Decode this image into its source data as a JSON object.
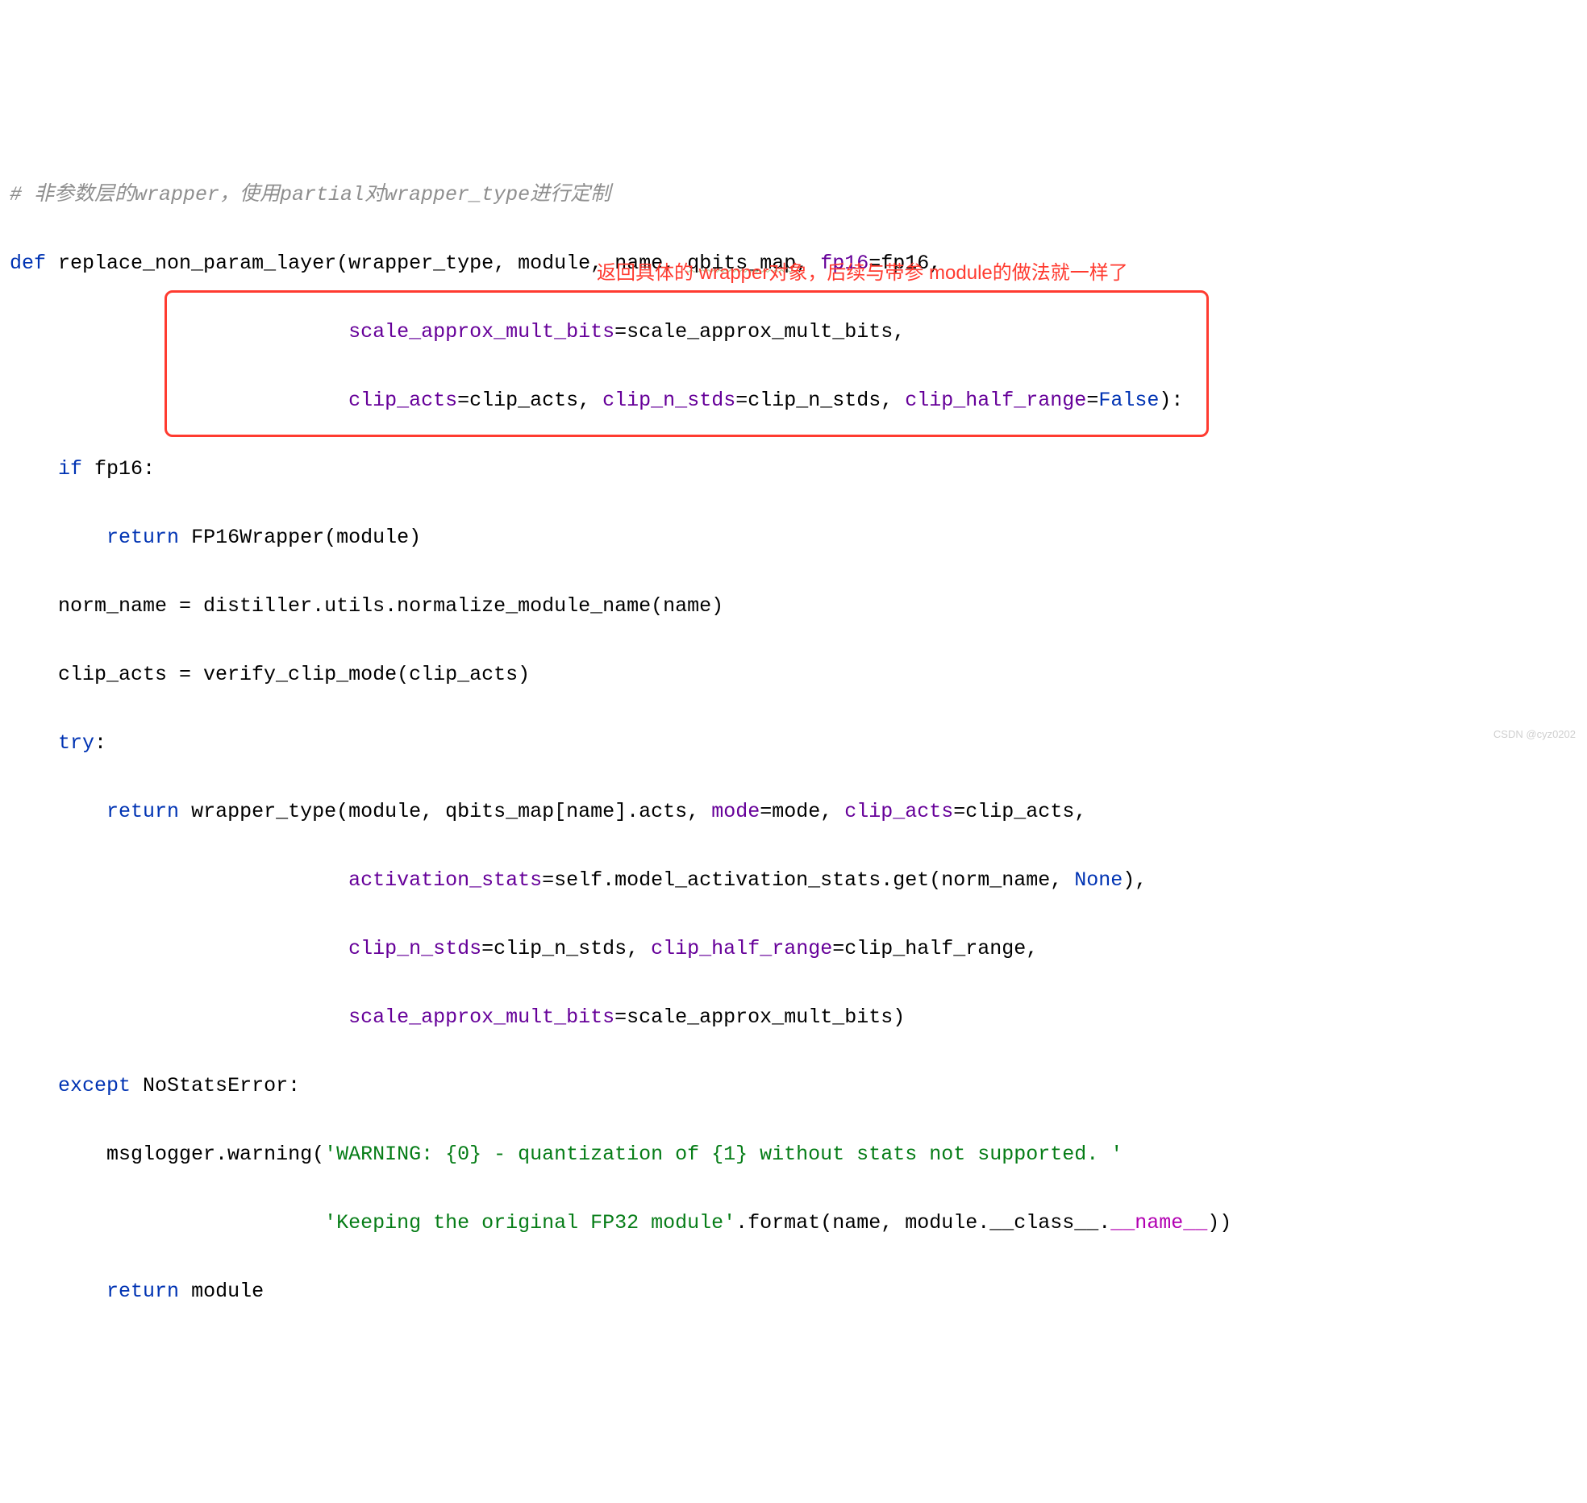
{
  "code": {
    "l1_comment": "# 非参数层的wrapper，使用partial对wrapper_type进行定制",
    "l2_def": "def",
    "l2_fname": "replace_non_param_layer",
    "l2_paren_open": "(",
    "l2_p_wrapper_type": "wrapper_type",
    "l2_p_module": "module",
    "l2_p_name": "name",
    "l2_p_qbits_map": "qbits_map",
    "l2_k_fp16": "fp16",
    "l2_v_fp16": "fp16",
    "l3_indent": "                            ",
    "l3_k_samb": "scale_approx_mult_bits",
    "l3_v_samb": "scale_approx_mult_bits",
    "l4_k_clip_acts": "clip_acts",
    "l4_v_clip_acts": "clip_acts",
    "l4_k_clip_n_stds": "clip_n_stds",
    "l4_v_clip_n_stds": "clip_n_stds",
    "l4_k_chr": "clip_half_range",
    "l4_v_false": "False",
    "l4_close": "):",
    "l5_if": "if",
    "l5_cond": "fp16",
    "l5_colon": ":",
    "l6_return": "return",
    "l6_call": "FP16Wrapper(module)",
    "l7_lhs": "norm_name = distiller.utils.normalize_module_name(name)",
    "l8_lhs": "clip_acts = verify_clip_mode(clip_acts)",
    "l9_try": "try",
    "l9_colon": ":",
    "l10_return": "return",
    "l10_call": "wrapper_type(module, qbits_map[name].acts,",
    "l10_k_mode": "mode",
    "l10_v_mode": "mode",
    "l10_k_clip_acts": "clip_acts",
    "l10_v_clip_acts": "clip_acts",
    "l10_trail": ",",
    "l11_indent": "                        ",
    "l11_k_as": "activation_stats",
    "l11_v_as": "=self.model_activation_stats.get(norm_name, ",
    "l11_none": "None",
    "l11_close": "),",
    "l12_k_cns": "clip_n_stds",
    "l12_v_cns": "clip_n_stds",
    "l12_k_chr": "clip_half_range",
    "l12_v_chr": "clip_half_range",
    "l12_trail": ",",
    "l13_k_samb": "scale_approx_mult_bits",
    "l13_v_samb": "scale_approx_mult_bits)",
    "l14_except": "except",
    "l14_ex": "NoStatsError",
    "l14_colon": ":",
    "l15_logger": "msglogger.warning(",
    "l15_str": "'WARNING: {0} - quantization of {1} without stats not supported. '",
    "l16_str": "'Keeping the original FP32 module'",
    "l16_format": ".format(name, module.__class__.",
    "l16_dunder": "__name__",
    "l16_close": "))",
    "l17_return": "return",
    "l17_val": "module"
  },
  "annotation": {
    "text": "返回具体的 wrapper对象，后续与带参 module的做法就一样了"
  },
  "watermark": "CSDN @cyz0202"
}
